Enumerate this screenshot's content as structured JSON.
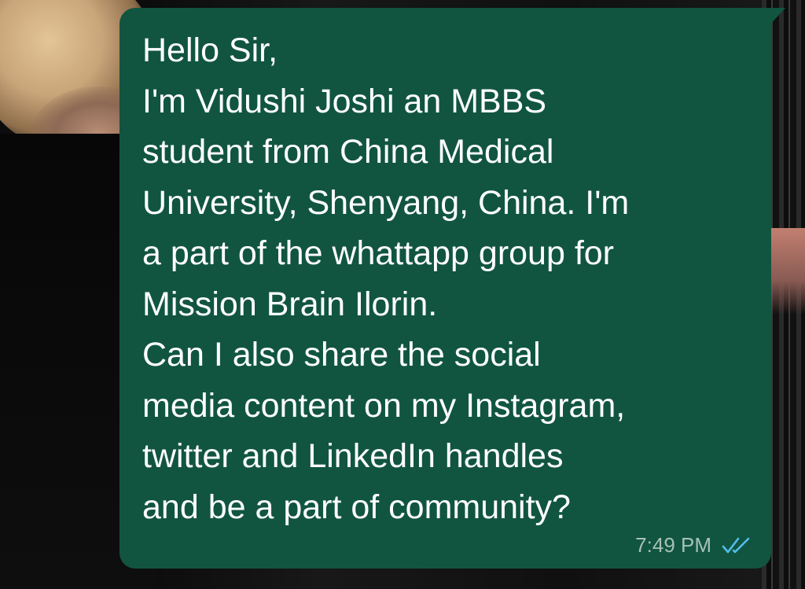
{
  "message": {
    "lines": [
      "Hello Sir,",
      "I'm Vidushi Joshi an MBBS",
      "student from China Medical",
      "University, Shenyang, China. I'm",
      "a part of the whattapp group for",
      "Mission Brain Ilorin.",
      "Can I also share the social",
      "media content on my Instagram,",
      "twitter and LinkedIn handles",
      "and be a part of community?"
    ],
    "time": "7:49 PM",
    "status_icon": "double-check-read-icon"
  },
  "colors": {
    "bubble": "#115540",
    "text": "#ffffff",
    "time": "#a6c1b6",
    "read_ticks": "#53bdeb"
  }
}
